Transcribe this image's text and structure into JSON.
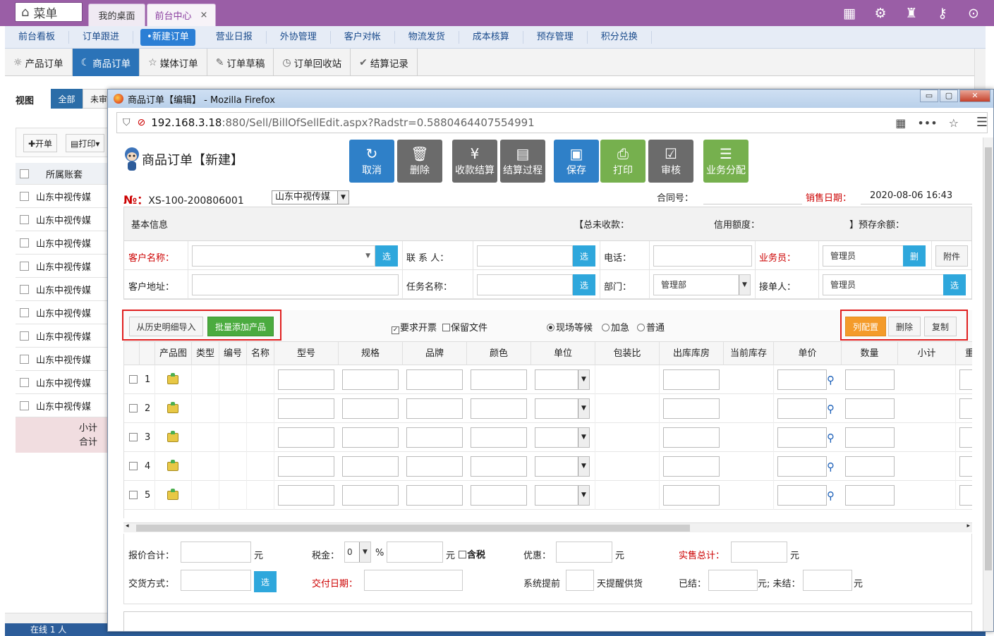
{
  "topbar": {
    "menu_label": "菜单",
    "tabs": [
      {
        "label": "我的桌面"
      },
      {
        "label": "前台中心",
        "close": "×"
      }
    ],
    "icons": [
      "grid-icon",
      "gear-icon",
      "shirt-icon",
      "key-icon",
      "chevron-down-icon"
    ]
  },
  "nav2": {
    "items": [
      "前台看板",
      "订单跟进",
      "•新建订单",
      "营业日报",
      "外协管理",
      "客户对帐",
      "物流发货",
      "成本核算",
      "预存管理",
      "积分兑换"
    ]
  },
  "nav3": {
    "tabs": [
      {
        "icon": "☼",
        "label": "产品订单"
      },
      {
        "icon": "☾",
        "label": "商品订单"
      },
      {
        "icon": "☆",
        "label": "媒体订单"
      },
      {
        "icon": "✎",
        "label": "订单草稿"
      },
      {
        "icon": "◷",
        "label": "订单回收站"
      },
      {
        "icon": "✔",
        "label": "结算记录"
      }
    ]
  },
  "bg": {
    "view_label": "视图",
    "all_label": "全部",
    "unset_label": "未审",
    "open_label": "✚开单",
    "print_label": "▤打印▾",
    "col_header": "所属账套",
    "rows": [
      "山东中视传媒",
      "山东中视传媒",
      "山东中视传媒",
      "山东中视传媒",
      "山东中视传媒",
      "山东中视传媒",
      "山东中视传媒",
      "山东中视传媒",
      "山东中视传媒",
      "山东中视传媒"
    ],
    "subtotal": "小计",
    "total": "合计",
    "status": "在线 1 人"
  },
  "firefox": {
    "title": "商品订单【编辑】 - Mozilla Firefox",
    "url_host": "192.168.3.18",
    "url_path": ":880/Sell/BillOfSellEdit.aspx?Radstr=0.5880464407554991"
  },
  "form": {
    "title": "商品订单【新建】",
    "actions": [
      {
        "icon": "↻",
        "label": "取消"
      },
      {
        "icon": "🗑",
        "label": "删除"
      },
      {
        "icon": "¥",
        "label": "收款结算"
      },
      {
        "icon": "▤",
        "label": "结算过程"
      },
      {
        "icon": "▣",
        "label": "保存"
      },
      {
        "icon": "⎙",
        "label": "打印"
      },
      {
        "icon": "☑",
        "label": "审核"
      },
      {
        "icon": "☰",
        "label": "业务分配"
      }
    ],
    "no_symbol": "№：",
    "no_value": "XS-100-200806001",
    "account": "山东中视传媒",
    "contract_label": "合同号：",
    "sale_date_label": "销售日期：",
    "sale_date": "2020-08-06 16:43",
    "info_head": {
      "basic": "基本信息",
      "unpaid": "【总未收款：",
      "credit": "信用额度：",
      "prepaid": "】预存余额："
    },
    "row1": {
      "customer_label": "客户名称：",
      "pick": "选",
      "contact_label": "联 系 人：",
      "phone_label": "电话：",
      "sales_label": "业务员：",
      "sales_value": "管理员",
      "del": "删",
      "attach": "附件"
    },
    "row2": {
      "address_label": "客户地址：",
      "task_label": "任务名称：",
      "dept_label": "部门：",
      "dept_value": "管理部",
      "receiver_label": "接单人：",
      "receiver_value": "管理员"
    },
    "toolbar": {
      "import_history": "从历史明细导入",
      "batch_add": "批量添加产品",
      "invoice": "要求开票",
      "keep_file": "保留文件",
      "wait": "现场等候",
      "urgent": "加急",
      "normal": "普通",
      "col_config": "列配置",
      "delete": "删除",
      "copy": "复制"
    },
    "grid_headers": [
      "产品图",
      "类型",
      "编号",
      "名称",
      "型号",
      "规格",
      "品牌",
      "颜色",
      "单位",
      "包装比",
      "出库库房",
      "当前库存",
      "单价",
      "数量",
      "小计",
      "重"
    ],
    "rows": [
      "1",
      "2",
      "3",
      "4",
      "5"
    ],
    "footer": {
      "quote_total": "报价合计：",
      "yuan": "元",
      "tax_label": "税金：",
      "tax_value": "0",
      "percent": "%",
      "tax_included": "含税",
      "discount": "优惠：",
      "actual_total": "实售总计：",
      "delivery_method": "交货方式：",
      "pick": "选",
      "delivery_date": "交付日期：",
      "remind_pre": "系统提前",
      "remind_post": "天提醒供货",
      "settled": "已结：",
      "unsettled": "元; 未结："
    }
  }
}
